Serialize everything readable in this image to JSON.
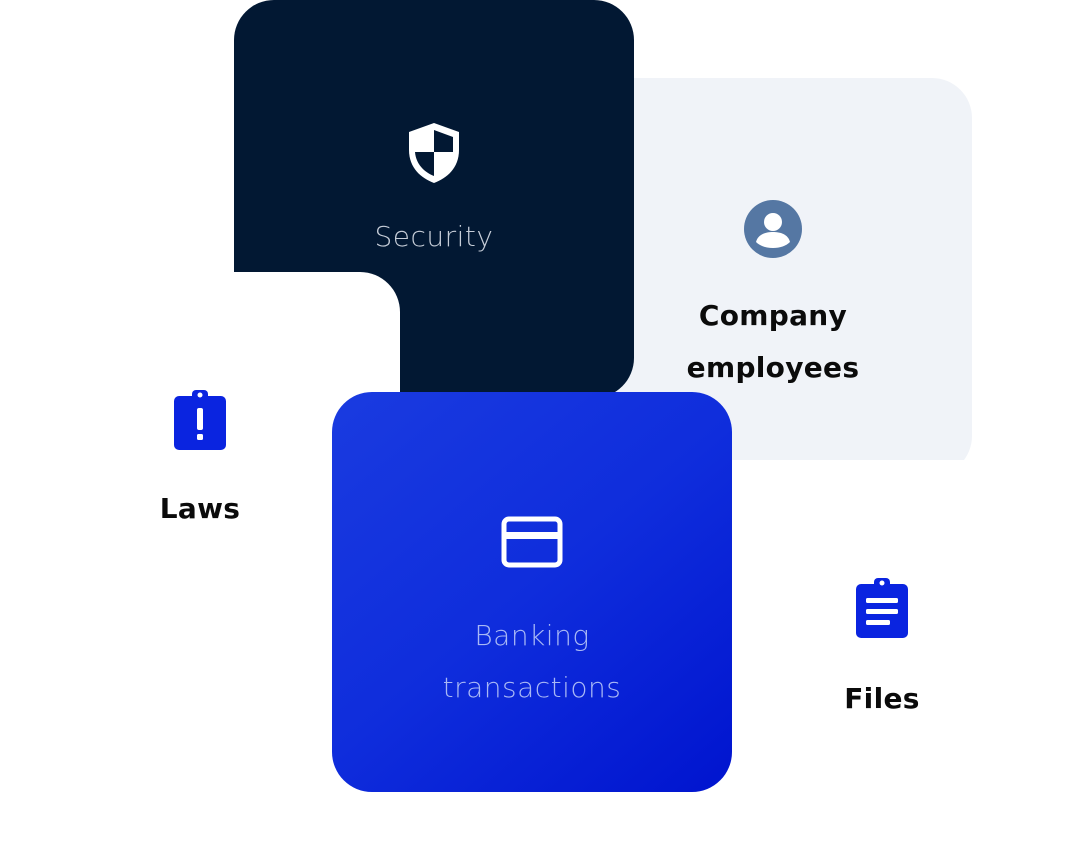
{
  "cards": {
    "security": {
      "label": "Security",
      "icon": "shield-icon"
    },
    "employees": {
      "label": "Company\nemployees",
      "icon": "user-circle-icon"
    },
    "laws": {
      "label": "Laws",
      "icon": "clipboard-alert-icon"
    },
    "banking": {
      "label": "Banking\ntransactions",
      "icon": "credit-card-icon"
    },
    "files": {
      "label": "Files",
      "icon": "clipboard-list-icon"
    }
  },
  "colors": {
    "navy": "#021833",
    "light_gray": "#f0f3f8",
    "blue": "#0f2ddc",
    "icon_blue": "#0a24e0",
    "user_icon": "#5577a3"
  }
}
